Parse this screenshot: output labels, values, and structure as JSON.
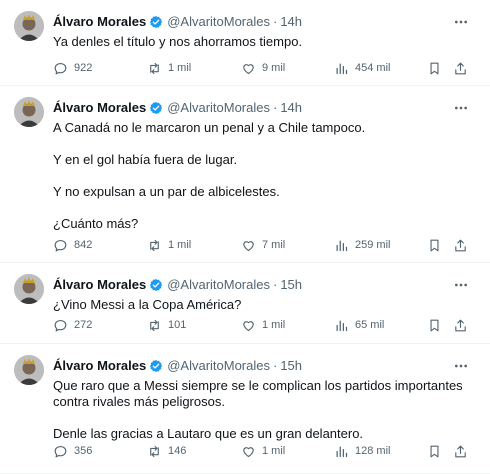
{
  "author": {
    "name": "Álvaro Morales",
    "handle": "@AlvaritoMorales",
    "separator": "·"
  },
  "colors": {
    "verified": "#1d9bf0",
    "secondary_text": "#536471",
    "primary_text": "#0f1419",
    "divider": "#eff3f4"
  },
  "icons": [
    "verified-badge-icon",
    "more-icon",
    "reply-icon",
    "retweet-icon",
    "like-icon",
    "views-icon",
    "bookmark-icon",
    "share-icon"
  ],
  "tweets": [
    {
      "time": "14h",
      "paragraphs": [
        "Ya denles el título y nos ahorramos tiempo."
      ],
      "stats": {
        "replies": "922",
        "retweets": "1 mil",
        "likes": "9 mil",
        "views": "454 mil"
      }
    },
    {
      "time": "14h",
      "paragraphs": [
        "A Canadá no le marcaron un penal y a Chile tampoco.",
        "Y en el gol había fuera de lugar.",
        "Y no expulsan a un par de albicelestes.",
        "¿Cuánto más?"
      ],
      "stats": {
        "replies": "842",
        "retweets": "1 mil",
        "likes": "7 mil",
        "views": "259 mil"
      }
    },
    {
      "time": "15h",
      "paragraphs": [
        "¿Vino Messi a la Copa América?"
      ],
      "stats": {
        "replies": "272",
        "retweets": "101",
        "likes": "1 mil",
        "views": "65 mil"
      }
    },
    {
      "time": "15h",
      "paragraphs": [
        "Que raro que a Messi siempre se le complican los partidos importantes contra rivales más peligrosos.",
        "Denle las gracias a Lautaro que es un gran delantero."
      ],
      "stats": {
        "replies": "356",
        "retweets": "146",
        "likes": "1 mil",
        "views": "128 mil"
      }
    }
  ]
}
